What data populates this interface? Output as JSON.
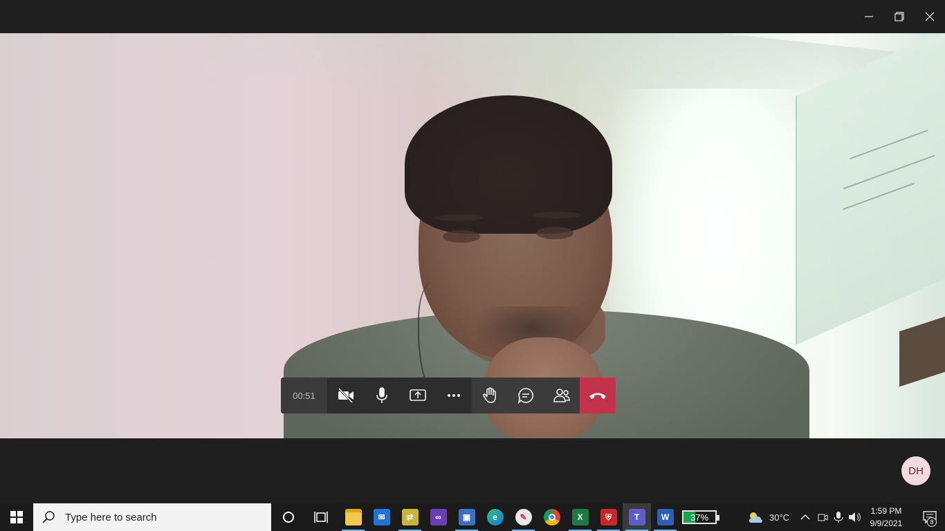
{
  "window": {
    "controls": {
      "minimize_icon": "minimize-icon",
      "restore_icon": "restore-icon",
      "close_icon": "close-icon"
    }
  },
  "call": {
    "duration": "00:51",
    "controls": [
      {
        "name": "camera-off",
        "icon": "video-off-icon"
      },
      {
        "name": "microphone",
        "icon": "mic-icon"
      },
      {
        "name": "share",
        "icon": "share-screen-icon"
      },
      {
        "name": "more",
        "icon": "more-icon"
      },
      {
        "name": "raise-hand",
        "icon": "hand-icon"
      },
      {
        "name": "chat",
        "icon": "chat-icon"
      },
      {
        "name": "participants",
        "icon": "people-icon"
      },
      {
        "name": "hang-up",
        "icon": "phone-hangup-icon"
      }
    ],
    "hangup_color": "#c4314b",
    "self_avatar_initials": "DH"
  },
  "taskbar": {
    "search_placeholder": "Type here to search",
    "pinned_apps": [
      {
        "name": "cortana",
        "icon": "circle-icon"
      },
      {
        "name": "task-view",
        "icon": "task-view-icon"
      },
      {
        "name": "file-explorer",
        "icon": "folder-icon"
      },
      {
        "name": "mail",
        "icon": "mail-icon"
      },
      {
        "name": "network-tool",
        "icon": "network-icon"
      },
      {
        "name": "visual-studio",
        "icon": "visual-studio-icon"
      },
      {
        "name": "remote-desktop",
        "icon": "remote-desktop-icon"
      },
      {
        "name": "edge",
        "icon": "edge-icon"
      },
      {
        "name": "paint",
        "icon": "paint-icon"
      },
      {
        "name": "chrome",
        "icon": "chrome-icon"
      },
      {
        "name": "excel",
        "icon": "excel-icon"
      },
      {
        "name": "security-app",
        "icon": "shield-icon"
      },
      {
        "name": "teams",
        "icon": "teams-icon"
      },
      {
        "name": "word",
        "icon": "word-icon"
      }
    ],
    "battery_percent": "37%",
    "battery_level": 0.37,
    "weather": "30°C",
    "time": "1:59 PM",
    "date": "9/9/2021",
    "notification_count": "8"
  }
}
